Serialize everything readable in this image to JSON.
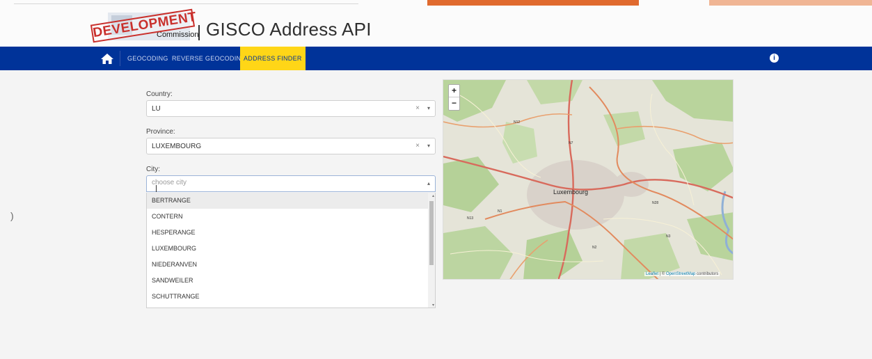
{
  "header": {
    "stamp_text": "DEVELOPMENT",
    "commission_text": "Commission",
    "app_title": "GISCO Address API"
  },
  "nav": {
    "home_icon": "home-icon",
    "items": [
      {
        "label": "GEOCODING"
      },
      {
        "label": "REVERSE GEOCODING"
      },
      {
        "label": "ADDRESS FINDER"
      }
    ],
    "active": "ADDRESS FINDER",
    "info_icon": "info-icon",
    "info_glyph": "i",
    "colors": {
      "background": "#003399",
      "active": "#ffd617"
    }
  },
  "form": {
    "country": {
      "label": "Country:",
      "value": "LU"
    },
    "province": {
      "label": "Province:",
      "value": "LUXEMBOURG"
    },
    "city": {
      "label": "City:",
      "placeholder": "choose city",
      "options": [
        "BERTRANGE",
        "CONTERN",
        "HESPERANGE",
        "LUXEMBOURG",
        "NIEDERANVEN",
        "SANDWEILER",
        "SCHUTTRANGE"
      ],
      "highlighted": "BERTRANGE"
    },
    "clear_glyph": "×",
    "caret_glyph": "▾",
    "caret_up_glyph": "▴"
  },
  "map": {
    "zoom_in": "+",
    "zoom_out": "−",
    "city_label": "Luxembourg",
    "road_labels": [
      "N12",
      "N7",
      "N1",
      "N13",
      "N2",
      "N28",
      "N3"
    ],
    "attribution": {
      "leaflet": "Leaflet",
      "sep": "|",
      "copy": "©",
      "osm": "OpenStreetMap",
      "contributors": "contributors"
    }
  },
  "misc": {
    "left_glyph": ")"
  }
}
